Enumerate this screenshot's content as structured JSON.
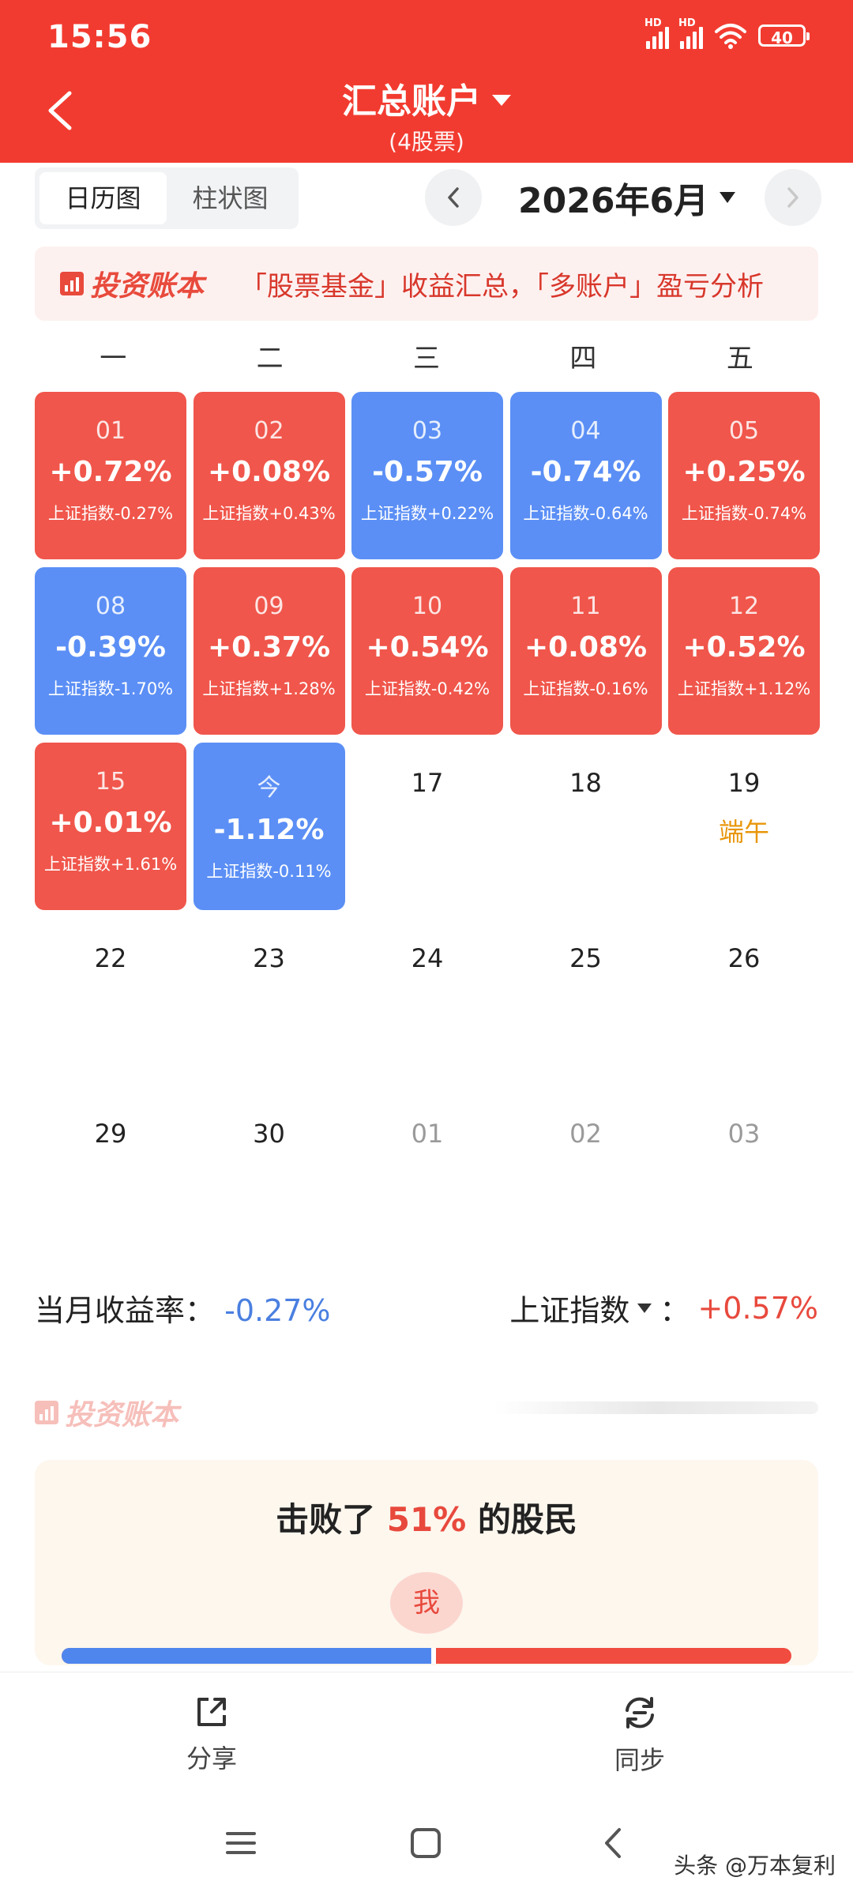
{
  "status_bar": {
    "time": "15:56",
    "signal1_label": "HD",
    "signal2_label": "HD",
    "battery": "40"
  },
  "header": {
    "title": "汇总账户",
    "subtitle": "(4股票)"
  },
  "view_toggle": {
    "calendar": "日历图",
    "bar": "柱状图"
  },
  "month": {
    "label": "2026年6月"
  },
  "banner": {
    "brand": "投资账本",
    "text": "「股票基金」收益汇总，「多账户」盈亏分析"
  },
  "weekdays": [
    "一",
    "二",
    "三",
    "四",
    "五"
  ],
  "calendar": {
    "cells": [
      {
        "date": "01",
        "pct": "+0.72%",
        "index": "上证指数-0.27%",
        "trend": "up"
      },
      {
        "date": "02",
        "pct": "+0.08%",
        "index": "上证指数+0.43%",
        "trend": "up"
      },
      {
        "date": "03",
        "pct": "-0.57%",
        "index": "上证指数+0.22%",
        "trend": "down"
      },
      {
        "date": "04",
        "pct": "-0.74%",
        "index": "上证指数-0.64%",
        "trend": "down"
      },
      {
        "date": "05",
        "pct": "+0.25%",
        "index": "上证指数-0.74%",
        "trend": "up"
      },
      {
        "date": "08",
        "pct": "-0.39%",
        "index": "上证指数-1.70%",
        "trend": "down"
      },
      {
        "date": "09",
        "pct": "+0.37%",
        "index": "上证指数+1.28%",
        "trend": "up"
      },
      {
        "date": "10",
        "pct": "+0.54%",
        "index": "上证指数-0.42%",
        "trend": "up"
      },
      {
        "date": "11",
        "pct": "+0.08%",
        "index": "上证指数-0.16%",
        "trend": "up"
      },
      {
        "date": "12",
        "pct": "+0.52%",
        "index": "上证指数+1.12%",
        "trend": "up"
      },
      {
        "date": "15",
        "pct": "+0.01%",
        "index": "上证指数+1.61%",
        "trend": "up"
      },
      {
        "date": "今",
        "pct": "-1.12%",
        "index": "上证指数-0.11%",
        "trend": "down"
      },
      {
        "date": "17"
      },
      {
        "date": "18"
      },
      {
        "date": "19",
        "holiday": "端午"
      },
      {
        "date": "22"
      },
      {
        "date": "23"
      },
      {
        "date": "24"
      },
      {
        "date": "25"
      },
      {
        "date": "26"
      },
      {
        "date": "29"
      },
      {
        "date": "30"
      },
      {
        "date": "01",
        "other_month": true
      },
      {
        "date": "02",
        "other_month": true
      },
      {
        "date": "03",
        "other_month": true
      }
    ]
  },
  "summary": {
    "monthly_label": "当月收益率：",
    "monthly_value": "-0.27%",
    "index_label": "上证指数",
    "index_colon": "：",
    "index_value": "+0.57%"
  },
  "beat": {
    "prefix": "击败了",
    "percent": "51%",
    "suffix": "的股民",
    "me_label": "我",
    "ratio": 0.51
  },
  "actions": {
    "share": "分享",
    "sync": "同步"
  },
  "watermark": "头条 @万本复利",
  "colors": {
    "header": "#f23b30",
    "up": "#f0564b",
    "down": "#5b8ff5",
    "holiday": "#e8960a"
  }
}
